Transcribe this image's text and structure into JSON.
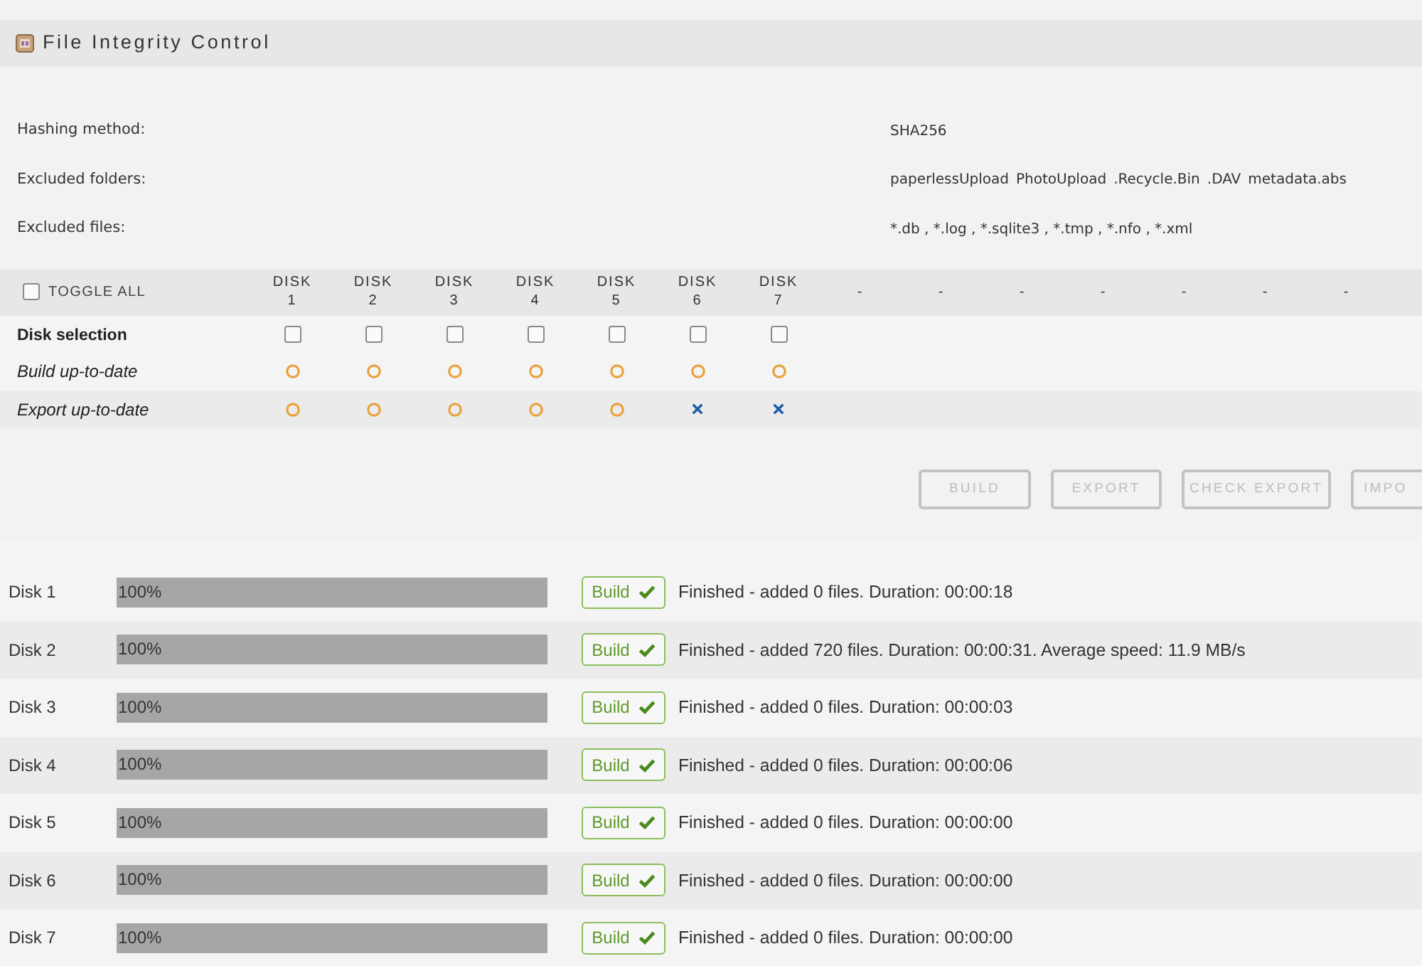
{
  "header": {
    "title": "File Integrity Control"
  },
  "settings": [
    {
      "label": "Hashing method:",
      "values": [
        "SHA256"
      ]
    },
    {
      "label": "Excluded folders:",
      "values": [
        "paperlessUpload",
        "PhotoUpload",
        ".Recycle.Bin",
        ".DAV",
        "metadata.abs"
      ]
    },
    {
      "label": "Excluded files:",
      "values": [
        "*.db , *.log , *.sqlite3 , *.tmp , *.nfo , *.xml"
      ]
    }
  ],
  "disk_table": {
    "toggle_all": {
      "label": "TOGGLE ALL",
      "checked": false
    },
    "columns": [
      {
        "label": "DISK",
        "number": "1"
      },
      {
        "label": "DISK",
        "number": "2"
      },
      {
        "label": "DISK",
        "number": "3"
      },
      {
        "label": "DISK",
        "number": "4"
      },
      {
        "label": "DISK",
        "number": "5"
      },
      {
        "label": "DISK",
        "number": "6"
      },
      {
        "label": "DISK",
        "number": "7"
      }
    ],
    "extra_columns": [
      "-",
      "-",
      "-",
      "-",
      "-",
      "-",
      "-"
    ],
    "rows": [
      {
        "label": "Disk selection",
        "kind": "checkbox",
        "cells": [
          {
            "checked": false
          },
          {
            "checked": false
          },
          {
            "checked": false
          },
          {
            "checked": false
          },
          {
            "checked": false
          },
          {
            "checked": false
          },
          {
            "checked": false
          }
        ]
      },
      {
        "label": "Build up-to-date",
        "kind": "status",
        "cells": [
          {
            "kind": "circle"
          },
          {
            "kind": "circle"
          },
          {
            "kind": "circle"
          },
          {
            "kind": "circle"
          },
          {
            "kind": "circle"
          },
          {
            "kind": "circle"
          },
          {
            "kind": "circle"
          }
        ]
      },
      {
        "label": "Export up-to-date",
        "kind": "status",
        "cells": [
          {
            "kind": "circle"
          },
          {
            "kind": "circle"
          },
          {
            "kind": "circle"
          },
          {
            "kind": "circle"
          },
          {
            "kind": "circle"
          },
          {
            "kind": "cross"
          },
          {
            "kind": "cross"
          }
        ]
      }
    ]
  },
  "actions": [
    {
      "label": "BUILD",
      "disabled": true
    },
    {
      "label": "EXPORT",
      "disabled": true
    },
    {
      "label": "CHECK EXPORT",
      "disabled": true
    },
    {
      "label": "IMPO",
      "disabled": true
    }
  ],
  "disks": [
    {
      "name": "Disk 1",
      "level": 1,
      "reading": "100%",
      "action": "Build",
      "done": true,
      "message": "Finished - added 0 files. Duration: 00:00:18"
    },
    {
      "name": "Disk 2",
      "level": 1,
      "reading": "100%",
      "action": "Build",
      "done": true,
      "message": "Finished - added 720 files. Duration: 00:00:31. Average speed: 11.9 MB/s"
    },
    {
      "name": "Disk 3",
      "level": 1,
      "reading": "100%",
      "action": "Build",
      "done": true,
      "message": "Finished - added 0 files. Duration: 00:00:03"
    },
    {
      "name": "Disk 4",
      "level": 1,
      "reading": "100%",
      "action": "Build",
      "done": true,
      "message": "Finished - added 0 files. Duration: 00:00:06"
    },
    {
      "name": "Disk 5",
      "level": 1,
      "reading": "100%",
      "action": "Build",
      "done": true,
      "message": "Finished - added 0 files. Duration: 00:00:00"
    },
    {
      "name": "Disk 6",
      "level": 1,
      "reading": "100%",
      "action": "Build",
      "done": true,
      "message": "Finished - added 0 files. Duration: 00:00:00"
    },
    {
      "name": "Disk 7",
      "level": 1,
      "reading": "100%",
      "action": "Build",
      "done": true,
      "message": "Finished - added 0 files. Duration: 00:00:00"
    }
  ]
}
